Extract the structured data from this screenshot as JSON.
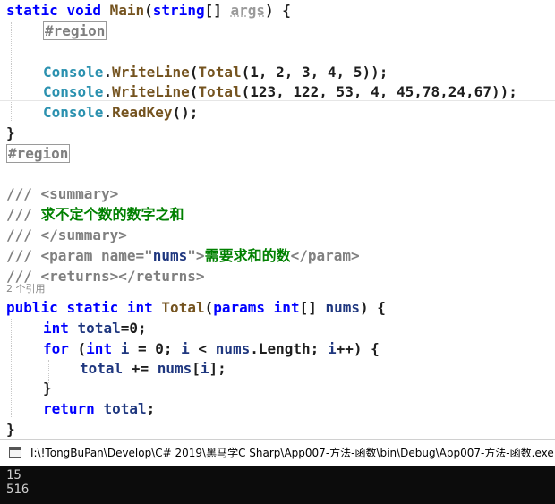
{
  "code": {
    "l1": {
      "kw1": "static",
      "kw2": "void",
      "fn": "Main",
      "p1": "(",
      "ty": "string",
      "p2": "[] ",
      "arg": "args",
      "p3": ") {"
    },
    "l2": {
      "region": "#region"
    },
    "l4": {
      "cls": "Console",
      "dot": ".",
      "m": "WriteLine",
      "p": "(",
      "fn": "Total",
      "rest": "(1, 2, 3, 4, 5));"
    },
    "l5": {
      "cls": "Console",
      "dot": ".",
      "m": "WriteLine",
      "p": "(",
      "fn": "Total",
      "rest": "(123, 122, 53, 4, 45,78,24,67));"
    },
    "l6": {
      "cls": "Console",
      "dot": ".",
      "m": "ReadKey",
      "rest": "();"
    },
    "l7": {
      "text": "}"
    },
    "l8": {
      "region": "#region"
    },
    "l10": {
      "slash": "///",
      "tag": " <summary>"
    },
    "l11": {
      "slash": "///",
      "text": " 求不定个数的数字之和"
    },
    "l12": {
      "slash": "///",
      "tag": " </summary>"
    },
    "l13": {
      "slash": "///",
      "t1": " <param ",
      "attr": "name",
      "eq": "=\"",
      "val": "nums",
      "t2": "\">",
      "text": "需要求和的数",
      "t3": "</param>"
    },
    "l14": {
      "slash": "///",
      "tag": " <returns></returns>"
    },
    "codelens": "2 个引用",
    "l15": {
      "kw1": "public",
      "kw2": "static",
      "kw3": "int",
      "fn": "Total",
      "p1": "(",
      "kw4": "params",
      "kw5": "int",
      "p2": "[] ",
      "pm": "nums",
      "p3": ") {"
    },
    "l16": {
      "kw": "int",
      "var": "total",
      "rest": "=0;"
    },
    "l17": {
      "kw": "for",
      "p1": " (",
      "kw2": "int",
      "var": "i",
      "p2": " = 0; ",
      "var2": "i",
      "p3": " < ",
      "pm": "nums",
      "p4": ".Length; ",
      "var3": "i",
      "p5": "++) {"
    },
    "l18": {
      "var": "total",
      "p1": " += ",
      "pm": "nums",
      "p2": "[",
      "var2": "i",
      "p3": "];"
    },
    "l19": {
      "text": "}"
    },
    "l20": {
      "kw": "return",
      "var": "total",
      "p": ";"
    },
    "l21": {
      "text": "}"
    }
  },
  "console": {
    "title": "I:\\!TongBuPan\\Develop\\C# 2019\\黑马学C Sharp\\App007-方法-函数\\bin\\Debug\\App007-方法-函数.exe",
    "output": [
      "15",
      "516"
    ]
  }
}
